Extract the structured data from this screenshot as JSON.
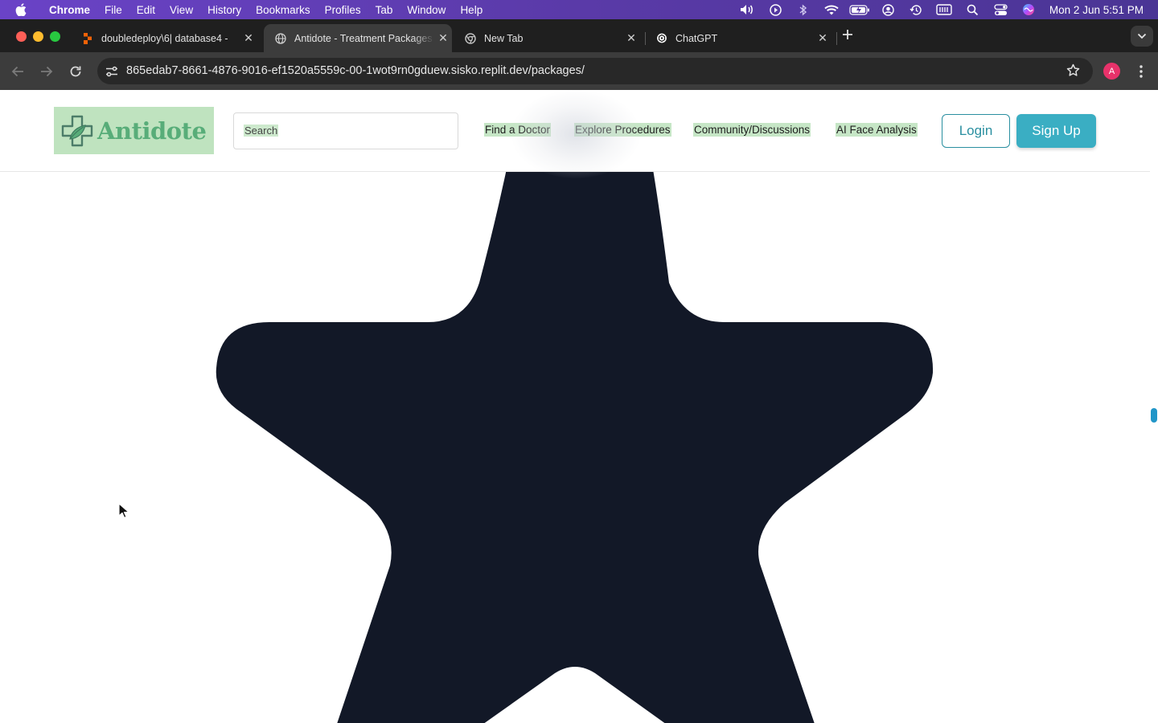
{
  "menubar": {
    "app_name": "Chrome",
    "items": [
      "File",
      "Edit",
      "View",
      "History",
      "Bookmarks",
      "Profiles",
      "Tab",
      "Window",
      "Help"
    ],
    "status_icons": [
      "volume-icon",
      "play-icon",
      "bluetooth-icon",
      "wifi-icon",
      "battery-icon",
      "user-icon",
      "time-machine-icon",
      "keyboard-icon",
      "spotlight-icon",
      "control-center-icon",
      "siri-icon"
    ],
    "clock": "Mon 2 Jun  5:51 PM"
  },
  "tabs": [
    {
      "title": "doubledeploy\\6| database4 -",
      "icon": "replit-icon"
    },
    {
      "title": "Antidote - Treatment Packages",
      "icon": "globe-icon",
      "active": true
    },
    {
      "title": "New Tab",
      "icon": "chrome-icon"
    },
    {
      "title": "ChatGPT",
      "icon": "openai-icon"
    }
  ],
  "toolbar": {
    "url": "865edab7-8661-4876-9016-ef1520a5559c-00-1wot9rn0gduew.sisko.replit.dev/packages/",
    "profile_initial": "A"
  },
  "site": {
    "brand": "Antidote",
    "search_placeholder": "Search",
    "nav": [
      "Find a Doctor",
      "Explore Procedures",
      "Community/Discussions",
      "AI Face Analysis"
    ],
    "login_label": "Login",
    "signup_label": "Sign Up"
  },
  "colors": {
    "menubar": "#5a3aa8",
    "star_fill": "#121827",
    "logo_bg": "#bfe3bf",
    "brand_green": "#58ad79",
    "accent_teal": "#3aaec3",
    "nav_highlight": "#c6e6c6"
  }
}
